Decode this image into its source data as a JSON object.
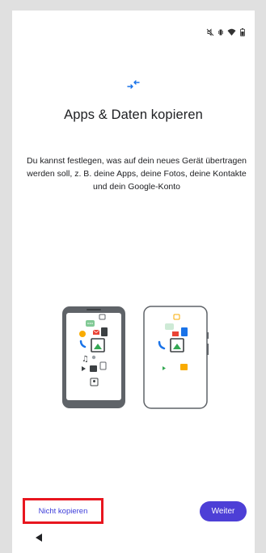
{
  "screen": {
    "title": "Apps & Daten kopieren",
    "description": "Du kannst festlegen, was auf dein neues Gerät übertragen werden soll, z. B. deine Apps, deine Fotos, deine Kontakte und dein Google-Konto",
    "header_icon": "transfer-arrows-icon",
    "illustration": "phone-transfer-illustration"
  },
  "status_bar": {
    "icons": [
      "mute-icon",
      "vibrate-icon",
      "wifi-icon",
      "battery-icon"
    ]
  },
  "actions": {
    "skip_label": "Nicht kopieren",
    "next_label": "Weiter"
  },
  "nav_bar": {
    "back_icon": "back-triangle-icon"
  },
  "colors": {
    "accent": "#4d3fd6",
    "link": "#3b3bd9",
    "highlight": "#e8161f",
    "frame": "#e0e0e0"
  }
}
